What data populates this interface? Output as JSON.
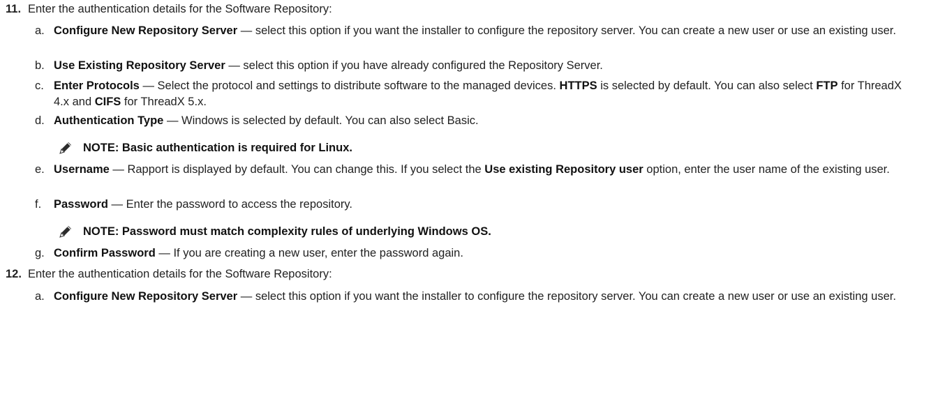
{
  "steps": [
    {
      "number": "11.",
      "text": "Enter the authentication details for the Software Repository:",
      "items": [
        {
          "letter": "a.",
          "bold": "Configure New Repository Server",
          "rest": " — select this option if you want the installer to configure the repository server. You can create a new user or use an existing user."
        },
        {
          "letter": "b.",
          "bold": "Use Existing Repository Server",
          "rest": " — select this option if you have already configured the Repository Server."
        },
        {
          "letter": "c.",
          "bold": "Enter Protocols",
          "rest1": " — Select the protocol and settings to distribute software to the managed devices. ",
          "bold2": "HTTPS",
          "rest2": " is selected by default. You can also select ",
          "bold3": "FTP",
          "rest3": " for ThreadX 4.x and ",
          "bold4": "CIFS",
          "rest4": " for ThreadX 5.x."
        },
        {
          "letter": "d.",
          "bold": "Authentication Type",
          "rest": " — Windows is selected by default. You can also select Basic."
        },
        {
          "letter": "e.",
          "bold": "Username",
          "rest1": " — Rapport is displayed by default. You can change this. If you select the ",
          "bold2": "Use existing Repository user",
          "rest2": " option, enter the user name of the existing user."
        },
        {
          "letter": "f.",
          "bold": "Password",
          "rest": " — Enter the password to access the repository."
        },
        {
          "letter": "g.",
          "bold": "Confirm Password",
          "rest": " — If you are creating a new user, enter the password again."
        }
      ]
    },
    {
      "number": "12.",
      "text": "Enter the authentication details for the Software Repository:",
      "items": [
        {
          "letter": "a.",
          "bold": "Configure New Repository Server",
          "rest": " — select this option if you want the installer to configure the repository server. You can create a new user or use an existing user."
        }
      ]
    }
  ],
  "notes": [
    {
      "icon": "pencil-note-icon",
      "text": "NOTE: Basic authentication is required for Linux."
    },
    {
      "icon": "pencil-note-icon",
      "text": "NOTE: Password must match complexity rules of underlying Windows OS."
    }
  ]
}
